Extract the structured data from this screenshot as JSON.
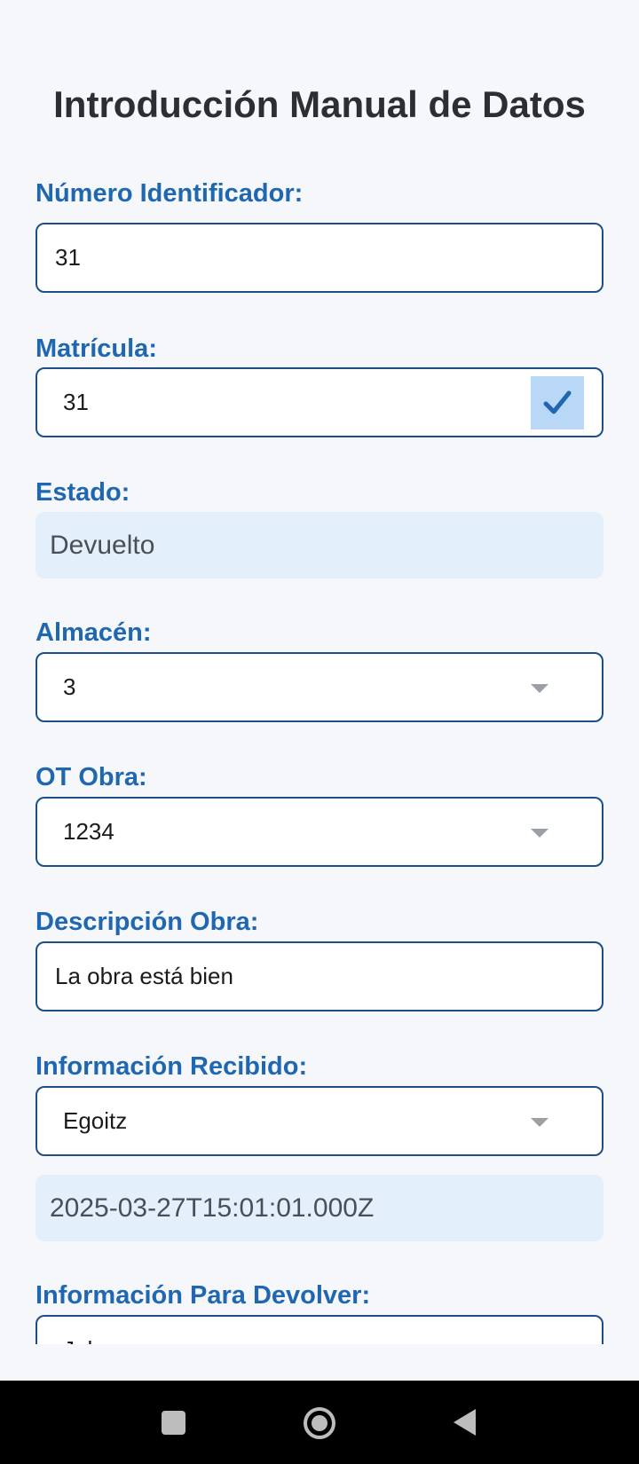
{
  "page": {
    "title": "Introducción Manual de Datos"
  },
  "form": {
    "numero_identificador": {
      "label": "Número Identificador:",
      "value": "31"
    },
    "matricula": {
      "label": "Matrícula:",
      "value": "31",
      "confirm_icon": "check-icon"
    },
    "estado": {
      "label": "Estado:",
      "value": "Devuelto"
    },
    "almacen": {
      "label": "Almacén:",
      "value": "3"
    },
    "ot_obra": {
      "label": "OT Obra:",
      "value": "1234"
    },
    "descripcion_obra": {
      "label": "Descripción Obra:",
      "value": "La obra está bien"
    },
    "informacion_recibido": {
      "label": "Información Recibido:",
      "value": "Egoitz",
      "timestamp": "2025-03-27T15:01:01.000Z"
    },
    "informacion_devolver": {
      "label": "Información Para Devolver:",
      "value": "Julen"
    }
  },
  "navbar": {
    "icons": [
      "recents-square-icon",
      "home-circle-icon",
      "back-triangle-icon"
    ]
  },
  "colors": {
    "label": "#1f67b1",
    "border": "#1d4f86",
    "readonly_bg": "#e3effb",
    "check_bg": "#b9d8f7",
    "background": "#f5f7fa"
  }
}
